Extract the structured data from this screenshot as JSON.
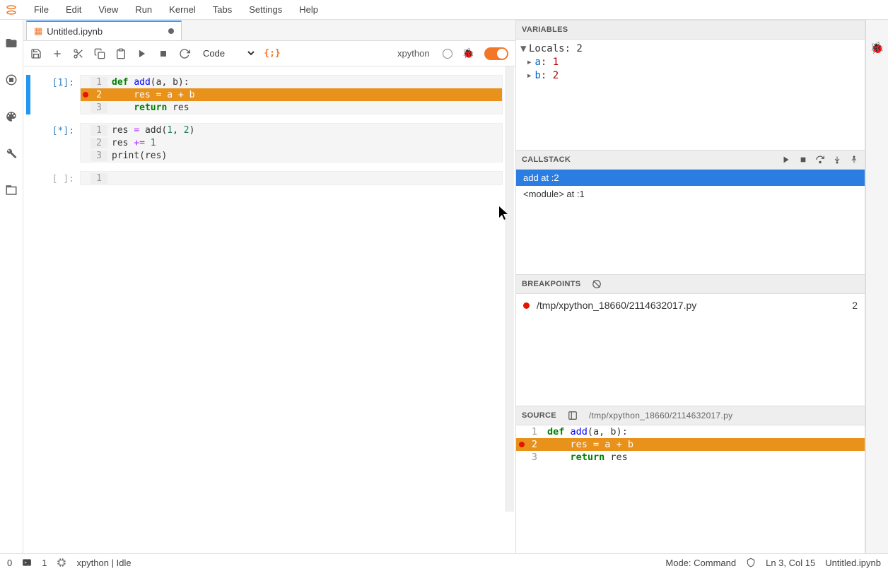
{
  "menu": {
    "items": [
      "File",
      "Edit",
      "View",
      "Run",
      "Kernel",
      "Tabs",
      "Settings",
      "Help"
    ]
  },
  "tab": {
    "title": "Untitled.ipynb"
  },
  "toolbar": {
    "celltype": "Code",
    "kernel": "xpython"
  },
  "cells": [
    {
      "prompt": "[1]:",
      "active": true,
      "lines": [
        {
          "n": "1",
          "bp": false,
          "exec": false,
          "html": "<span class='kw'>def</span> <span class='fn'>add</span>(a, b):"
        },
        {
          "n": "2",
          "bp": true,
          "exec": true,
          "html": "    res <span class='op'>=</span> a <span class='op'>+</span> b"
        },
        {
          "n": "3",
          "bp": false,
          "exec": false,
          "html": "    <span class='kw'>return</span> res"
        }
      ]
    },
    {
      "prompt": "[*]:",
      "active": false,
      "lines": [
        {
          "n": "1",
          "bp": false,
          "exec": false,
          "html": "res <span class='op'>=</span> add(<span class='num'>1</span>, <span class='num'>2</span>)"
        },
        {
          "n": "2",
          "bp": false,
          "exec": false,
          "html": "res <span class='op'>+=</span> <span class='num'>1</span>"
        },
        {
          "n": "3",
          "bp": false,
          "exec": false,
          "html": "print(res)"
        }
      ]
    },
    {
      "prompt": "[ ]:",
      "active": false,
      "grey": true,
      "lines": [
        {
          "n": "1",
          "bp": false,
          "exec": false,
          "html": ""
        }
      ]
    }
  ],
  "variables": {
    "title": "VARIABLES",
    "scope": "Locals: 2",
    "items": [
      {
        "name": "a",
        "value": "1"
      },
      {
        "name": "b",
        "value": "2"
      }
    ]
  },
  "callstack": {
    "title": "CALLSTACK",
    "frames": [
      {
        "label": "add at :2",
        "sel": true
      },
      {
        "label": "<module> at :1",
        "sel": false
      }
    ]
  },
  "breakpoints": {
    "title": "BREAKPOINTS",
    "items": [
      {
        "path": "/tmp/xpython_18660/2114632017.py",
        "line": "2"
      }
    ]
  },
  "source": {
    "title": "SOURCE",
    "path": "/tmp/xpython_18660/2114632017.py",
    "lines": [
      {
        "n": "1",
        "bp": false,
        "exec": false,
        "html": "<span class='kw'>def</span> <span class='fn'>add</span>(a, b):"
      },
      {
        "n": "2",
        "bp": true,
        "exec": true,
        "html": "    res <span class='op'>=</span> a <span class='op'>+</span> b"
      },
      {
        "n": "3",
        "bp": false,
        "exec": false,
        "html": "    <span class='kw'>return</span> res"
      }
    ]
  },
  "status": {
    "left_num": "0",
    "terminals": "1",
    "kernel": "xpython | Idle",
    "mode": "Mode: Command",
    "pos": "Ln 3, Col 15",
    "file": "Untitled.ipynb"
  }
}
